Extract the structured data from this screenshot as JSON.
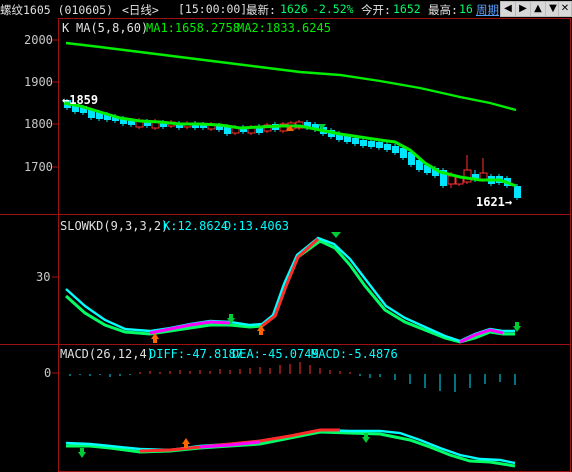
{
  "header": {
    "symbol": "螺纹1605 (010605)",
    "period": "<日线>",
    "time": "[15:00:00]",
    "latest_label": "最新:",
    "latest_value": "1626",
    "change_pct": "-2.52%",
    "open_label": "今开:",
    "open_value": "1652",
    "high_label": "最高:",
    "high_value": "16",
    "cycle_link": "周期",
    "nav_icons": [
      "arrow-left-icon",
      "arrow-right-icon",
      "arrow-up-icon",
      "arrow-down-icon",
      "zoom-icon",
      "close-icon"
    ]
  },
  "colors": {
    "background": "#000000",
    "grid": "#8b0000",
    "up": "#ff3030",
    "down": "#00e5ff",
    "ma_short": "#00ee00",
    "ma_long": "#00ee00",
    "k_line": "#ff2a2a",
    "d_line": "#00ff66",
    "diff_line": "#00ffff",
    "dea_line": "#ff00ff",
    "axis_text": "#c8c8c8"
  },
  "main_panel": {
    "legend_k": "K",
    "legend_ma": "MA(5,8,60)",
    "ma1_text": "MA1:1658.2758",
    "ma2_text": "MA2:1833.6245",
    "y_ticks": [
      "2000",
      "1900",
      "1800",
      "1700"
    ],
    "annotation_high": "←1859",
    "annotation_low": "1621→"
  },
  "kd_panel": {
    "title": "SLOWKD(9,3,3,2)",
    "k_text": "K:12.8624",
    "d_text": "D:13.4063",
    "y_ticks": [
      "30"
    ]
  },
  "macd_panel": {
    "title": "MACD(26,12,4)",
    "diff_text": "DIFF:-47.8187",
    "dea_text": "DEA:-45.0749",
    "macd_text": "MACD:-5.4876",
    "y_ticks": [
      "0"
    ]
  }
}
